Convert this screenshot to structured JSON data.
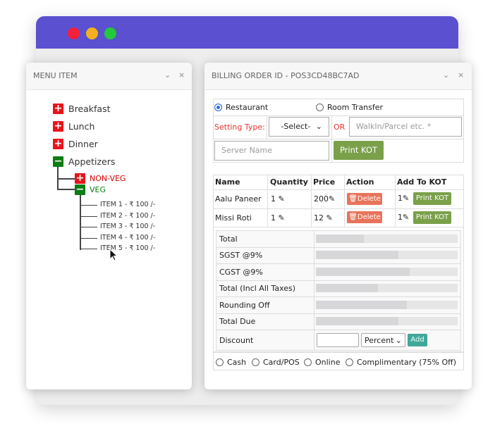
{
  "window": {
    "colors": {
      "titlebar": "#5a50d0",
      "close": "#f5213a",
      "minimize": "#f4b020",
      "maximize": "#22c93a"
    }
  },
  "menu": {
    "title": "MENU ITEM",
    "chevron": "chevron-down-icon",
    "close": "×",
    "categories": [
      {
        "label": "Breakfast",
        "state": "collapsed"
      },
      {
        "label": "Lunch",
        "state": "collapsed"
      },
      {
        "label": "Dinner",
        "state": "collapsed"
      },
      {
        "label": "Appetizers",
        "state": "expanded"
      }
    ],
    "sub": [
      {
        "label": "NON-VEG",
        "color": "#d40000"
      },
      {
        "label": "VEG",
        "color": "#0a7d14"
      }
    ],
    "items": [
      "ITEM 1 - ₹ 100 /-",
      "ITEM 2 - ₹ 100 /-",
      "ITEM 3 - ₹ 100 /-",
      "ITEM 4 - ₹ 100 /-",
      "ITEM 5 - ₹ 100 /-"
    ]
  },
  "billing": {
    "title": "BILLING ORDER ID - POS3CD48BC7AD",
    "close": "×",
    "order_type": {
      "options": [
        "Restaurant",
        "Room Transfer"
      ],
      "selected": "Restaurant"
    },
    "setting_label": "Setting Type:",
    "setting_value": "-Select-",
    "or": "OR",
    "walkin_placeholder": "WalkIn/Parcel etc. *",
    "server_placeholder": "Server Name",
    "print_kot": "Print KOT",
    "columns": [
      "Name",
      "Quantity",
      "Price",
      "Action",
      "Add To KOT"
    ],
    "rows": [
      {
        "name": "Aalu Paneer",
        "qty": "1",
        "price": "200",
        "action": "Delete",
        "kot_qty": "1",
        "kot_btn": "Print KOT"
      },
      {
        "name": "Missi Roti",
        "qty": "1",
        "price": "12",
        "action": "Delete",
        "kot_qty": "1",
        "kot_btn": "Print KOT"
      }
    ],
    "summary": [
      "Total",
      "SGST @9%",
      "CGST @9%",
      "Total (Incl All Taxes)",
      "Rounding Off",
      "Total Due"
    ],
    "discount_label": "Discount",
    "discount_value": "",
    "discount_type": "Percent",
    "add": "Add",
    "payments": [
      "Cash",
      "Card/POS",
      "Online",
      "Complimentary (75% Off)"
    ]
  }
}
